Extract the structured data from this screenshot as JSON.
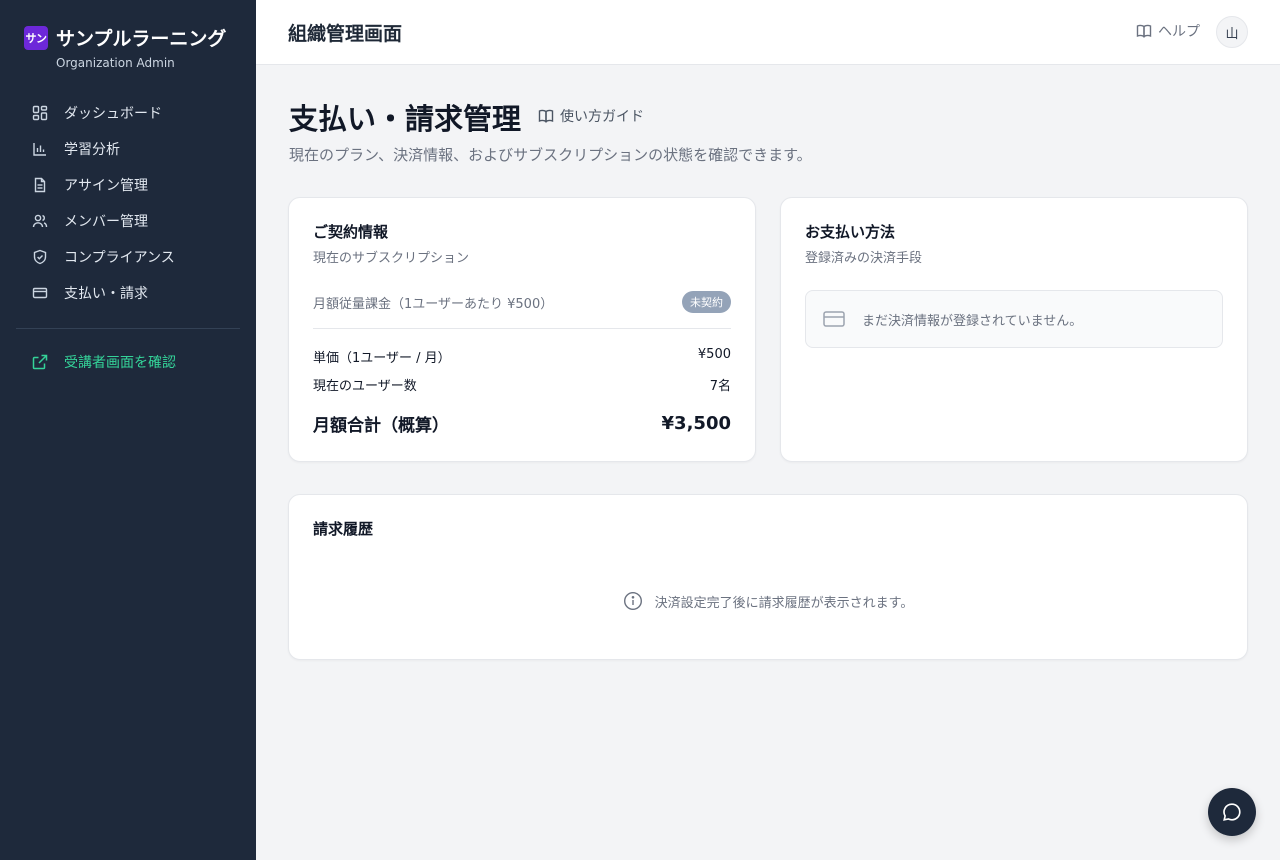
{
  "brand": {
    "logo": "サン",
    "name": "サンプルラーニング",
    "subtitle": "Organization Admin"
  },
  "sidebar": {
    "items": [
      {
        "label": "ダッシュボード",
        "icon": "dashboard-icon"
      },
      {
        "label": "学習分析",
        "icon": "bar-chart-icon"
      },
      {
        "label": "アサイン管理",
        "icon": "document-icon"
      },
      {
        "label": "メンバー管理",
        "icon": "users-icon"
      },
      {
        "label": "コンプライアンス",
        "icon": "shield-icon"
      },
      {
        "label": "支払い・請求",
        "icon": "credit-card-icon"
      }
    ],
    "external_link": {
      "label": "受講者画面を確認",
      "icon": "external-link-icon"
    }
  },
  "header": {
    "title": "組織管理画面",
    "help_label": "ヘルプ",
    "avatar_initial": "山"
  },
  "page": {
    "title": "支払い・請求管理",
    "guide_label": "使い方ガイド",
    "description": "現在のプラン、決済情報、およびサブスクリプションの状態を確認できます。"
  },
  "contract": {
    "title": "ご契約情報",
    "subtitle": "現在のサブスクリプション",
    "plan_name": "月額従量課金（1ユーザーあたり ¥500）",
    "status_badge": "未契約",
    "unit_price_label": "単価（1ユーザー / 月）",
    "unit_price_value": "¥500",
    "users_label": "現在のユーザー数",
    "users_value": "7名",
    "total_label": "月額合計（概算）",
    "total_value": "¥3,500"
  },
  "payment": {
    "title": "お支払い方法",
    "subtitle": "登録済みの決済手段",
    "empty_message": "まだ決済情報が登録されていません。"
  },
  "history": {
    "title": "請求履歴",
    "empty_message": "決済設定完了後に請求履歴が表示されます。"
  },
  "colors": {
    "sidebar_bg": "#1e293b",
    "accent_green": "#34d399",
    "brand_purple": "#6d28d9",
    "badge_gray": "#94a3b8"
  }
}
